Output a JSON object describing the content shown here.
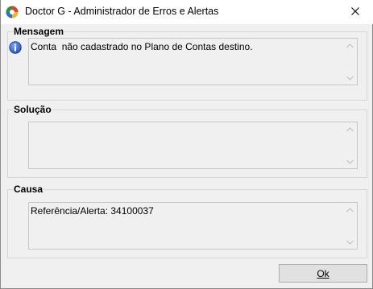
{
  "window": {
    "title": "Doctor G - Administrador de Erros e Alertas",
    "app_icon": "doctor-g-logo-icon",
    "close_icon": "close-icon"
  },
  "sections": {
    "mensagem": {
      "legend": "Mensagem",
      "icon": "info-icon",
      "text": "Conta  não cadastrado no Plano de Contas destino."
    },
    "solucao": {
      "legend": "Solução",
      "text": ""
    },
    "causa": {
      "legend": "Causa",
      "text": "Referência/Alerta: 34100037"
    }
  },
  "buttons": {
    "ok_label": "Ok"
  },
  "colors": {
    "window_bg": "#f0f0f0",
    "titlebar_bg": "#ffffff",
    "info_blue": "#3b6fd1",
    "button_bg": "#e1e1e1"
  }
}
